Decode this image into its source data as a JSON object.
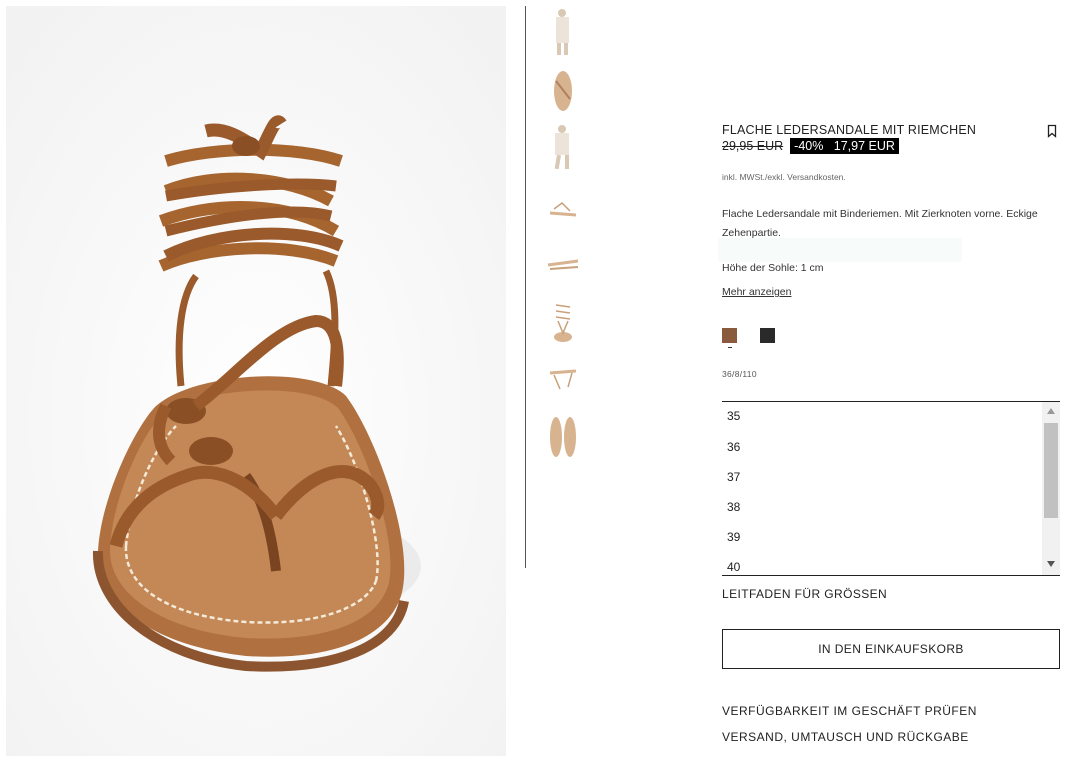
{
  "product": {
    "title": "FLACHE LEDERSANDALE MIT RIEMCHEN",
    "old_price": "29,95 EUR",
    "discount": "-40%",
    "new_price": "17,97 EUR",
    "tax_note": "inkl. MWSt./exkl. Versandkosten.",
    "description": "Flache Ledersandale mit Binderiemen. Mit Zierknoten vorne. Eckige Zehenpartie.",
    "sole_height": "Höhe der Sohle: 1 cm",
    "more_link": "Mehr anzeigen",
    "reference": "36/8/110",
    "colors": [
      {
        "name": "brown",
        "hex": "#8a5a3c",
        "selected": true
      },
      {
        "name": "black",
        "hex": "#2a2a2a",
        "selected": false
      }
    ]
  },
  "sizes": [
    "35",
    "36",
    "37",
    "38",
    "39",
    "40"
  ],
  "actions": {
    "size_guide": "LEITFADEN FÜR GRÖSSEN",
    "add_to_cart": "IN DEN EINKAUFSKORB",
    "store_availability": "VERFÜGBARKEIT IM GESCHÄFT PRÜFEN",
    "shipping": "VERSAND, UMTAUSCH UND RÜCKGABE"
  },
  "icons": {
    "bookmark": "bookmark-icon",
    "scroll_up": "chevron-up-icon",
    "scroll_down": "chevron-down-icon"
  },
  "gallery": {
    "thumbnail_count": 8
  }
}
